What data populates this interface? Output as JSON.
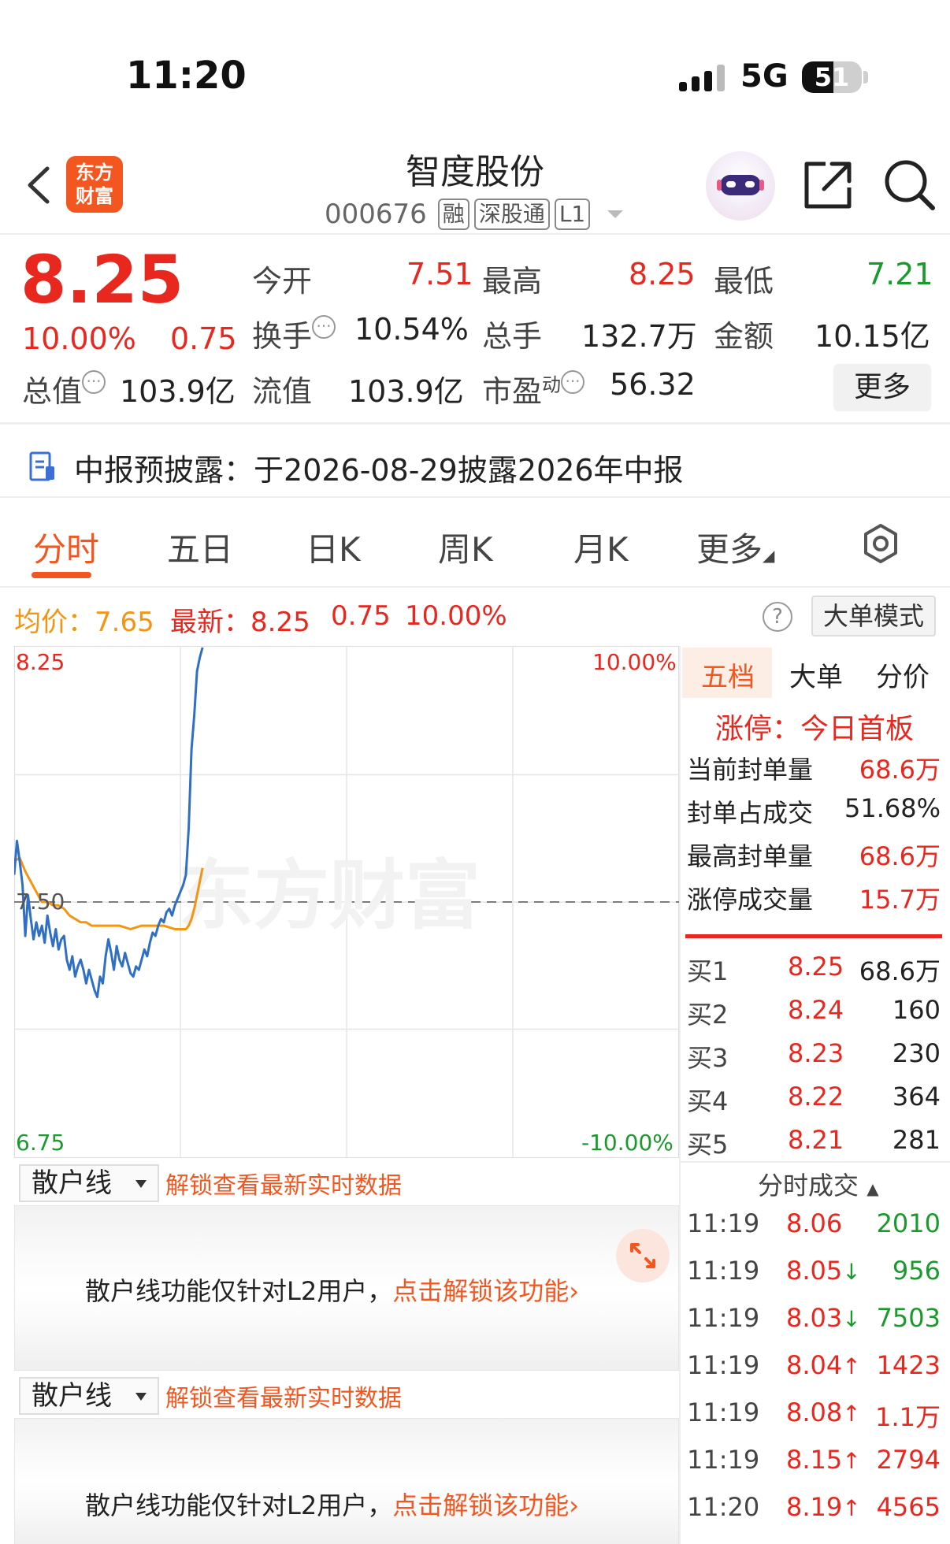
{
  "status_bar": {
    "time": "11:20",
    "network": "5G",
    "battery": "51"
  },
  "header": {
    "logo_text_1": "东方",
    "logo_text_2": "财富",
    "stock_name": "智度股份",
    "stock_code": "000676",
    "tags": [
      "融",
      "深股通",
      "L1"
    ]
  },
  "quote": {
    "price": "8.25",
    "change_pct": "10.00%",
    "change": "0.75",
    "open_label": "今开",
    "open": "7.51",
    "high_label": "最高",
    "high": "8.25",
    "low_label": "最低",
    "low": "7.21",
    "turnover_label": "换手",
    "turnover": "10.54%",
    "volume_label": "总手",
    "volume": "132.7万",
    "amount_label": "金额",
    "amount": "10.15亿",
    "mktcap_label": "总值",
    "mktcap": "103.9亿",
    "float_label": "流值",
    "float": "103.9亿",
    "pe_label": "市盈",
    "pe_sup": "动",
    "pe": "56.32",
    "more_button": "更多"
  },
  "notice": {
    "label": "中报预披露：",
    "text": "于2026-08-29披露2026年中报"
  },
  "tabs": [
    "分时",
    "五日",
    "日K",
    "周K",
    "月K",
    "更多"
  ],
  "avg_row": {
    "avg_label": "均价：",
    "avg": "7.65",
    "latest_label": "最新：",
    "latest": "8.25",
    "latest_chg": "0.75",
    "latest_pct": "10.00%",
    "help": "?",
    "mode_button": "大单模式"
  },
  "chart_data": {
    "type": "line",
    "y_top": "8.25",
    "y_mid": "7.50",
    "y_bottom": "6.75",
    "pct_top": "10.00%",
    "pct_bottom": "-10.00%",
    "ylim": [
      6.75,
      8.25
    ],
    "prev_close": 7.5,
    "watermark": "东方财富",
    "series": [
      {
        "color": "#2f6fc4",
        "x": [
          0,
          1,
          2,
          3,
          4,
          5,
          6,
          7,
          8,
          9,
          10,
          11,
          12,
          13,
          14,
          15,
          16,
          17,
          18,
          19,
          20,
          21,
          22,
          23,
          24,
          25,
          26,
          27,
          28,
          29,
          30,
          31,
          32,
          33,
          34,
          35,
          36,
          37,
          38,
          39,
          40,
          41,
          42,
          43,
          44,
          45,
          46,
          47,
          48,
          49,
          50,
          51,
          52,
          53,
          54,
          55,
          56,
          57,
          58,
          59,
          60,
          61,
          62,
          63,
          64,
          65,
          66,
          67,
          68
        ],
        "values": [
          7.58,
          7.68,
          7.62,
          7.55,
          7.4,
          7.52,
          7.45,
          7.39,
          7.44,
          7.4,
          7.43,
          7.38,
          7.46,
          7.41,
          7.37,
          7.42,
          7.36,
          7.39,
          7.4,
          7.33,
          7.3,
          7.34,
          7.28,
          7.31,
          7.33,
          7.3,
          7.26,
          7.3,
          7.27,
          7.24,
          7.22,
          7.28,
          7.26,
          7.34,
          7.39,
          7.35,
          7.3,
          7.37,
          7.33,
          7.31,
          7.35,
          7.32,
          7.29,
          7.28,
          7.31,
          7.3,
          7.33,
          7.36,
          7.34,
          7.38,
          7.41,
          7.4,
          7.43,
          7.45,
          7.44,
          7.47,
          7.48,
          7.46,
          7.49,
          7.51,
          7.53,
          7.55,
          7.58,
          7.72,
          7.95,
          8.05,
          8.18,
          8.22,
          8.25
        ]
      },
      {
        "color": "#f39512",
        "x": [
          0,
          2,
          4,
          6,
          8,
          10,
          12,
          14,
          16,
          18,
          20,
          22,
          24,
          26,
          28,
          30,
          34,
          38,
          42,
          46,
          50,
          54,
          58,
          60,
          62,
          63,
          64,
          65,
          66,
          67,
          68
        ],
        "values": [
          7.62,
          7.63,
          7.59,
          7.56,
          7.53,
          7.5,
          7.5,
          7.49,
          7.49,
          7.48,
          7.46,
          7.45,
          7.44,
          7.44,
          7.43,
          7.43,
          7.43,
          7.43,
          7.42,
          7.43,
          7.43,
          7.43,
          7.42,
          7.42,
          7.42,
          7.43,
          7.45,
          7.48,
          7.52,
          7.56,
          7.6
        ]
      }
    ]
  },
  "orderbook": {
    "tabs": [
      "五档",
      "大单",
      "分价"
    ],
    "limit_title": "涨停：今日首板",
    "stats": [
      {
        "label": "当前封单量",
        "value": "68.6万",
        "color": "red"
      },
      {
        "label": "封单占成交",
        "value": "51.68%",
        "color": "black"
      },
      {
        "label": "最高封单量",
        "value": "68.6万",
        "color": "red"
      },
      {
        "label": "涨停成交量",
        "value": "15.7万",
        "color": "red"
      }
    ],
    "bids": [
      {
        "label": "买1",
        "price": "8.25",
        "vol": "68.6万"
      },
      {
        "label": "买2",
        "price": "8.24",
        "vol": "160"
      },
      {
        "label": "买3",
        "price": "8.23",
        "vol": "230"
      },
      {
        "label": "买4",
        "price": "8.22",
        "vol": "364"
      },
      {
        "label": "买5",
        "price": "8.21",
        "vol": "281"
      }
    ],
    "ticks_title": "分时成交",
    "ticks": [
      {
        "time": "11:19",
        "price": "8.06",
        "arrow": "",
        "vol": "2010",
        "vol_color": "green"
      },
      {
        "time": "11:19",
        "price": "8.05",
        "arrow": "↓",
        "vol": "956",
        "vol_color": "green"
      },
      {
        "time": "11:19",
        "price": "8.03",
        "arrow": "↓",
        "vol": "7503",
        "vol_color": "green"
      },
      {
        "time": "11:19",
        "price": "8.04",
        "arrow": "↑",
        "vol": "1423",
        "vol_color": "red"
      },
      {
        "time": "11:19",
        "price": "8.08",
        "arrow": "↑",
        "vol": "1.1万",
        "vol_color": "red"
      },
      {
        "time": "11:19",
        "price": "8.15",
        "arrow": "↑",
        "vol": "2794",
        "vol_color": "red"
      },
      {
        "time": "11:20",
        "price": "8.19",
        "arrow": "↑",
        "vol": "4565",
        "vol_color": "red"
      }
    ]
  },
  "retail_panels": [
    {
      "dropdown": "散户线",
      "unlock_link": "解锁查看最新实时数据",
      "message": "散户线功能仅针对L2用户，",
      "message_link": "点击解锁该功能"
    },
    {
      "dropdown": "散户线",
      "unlock_link": "解锁查看最新实时数据",
      "message": "散户线功能仅针对L2用户，",
      "message_link": "点击解锁该功能"
    }
  ]
}
